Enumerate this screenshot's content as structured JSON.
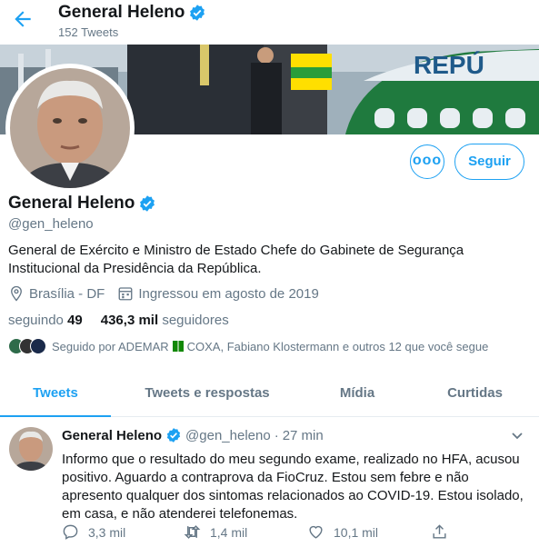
{
  "header": {
    "name": "General Heleno",
    "tweet_count": "152 Tweets"
  },
  "profile": {
    "name": "General Heleno",
    "handle": "@gen_heleno",
    "bio": "General de Exército e Ministro de Estado Chefe do Gabinete de Segurança Institucional da Presidência da República.",
    "bio_line1": "General de Exército e Ministro de Estado Chefe do Gabinete de Segurança",
    "bio_line2": "Institucional da Presidência da República.",
    "location": "Brasília - DF",
    "joined": "Ingressou em agosto de 2019",
    "following_count": "49",
    "following_label": "seguindo",
    "followers_count": "436,3 mil",
    "followers_label": "seguidores",
    "followed_by_prefix": "Seguido por ADEMAR",
    "followed_by_suffix": "COXA, Fabiano Klostermann e outros 12 que você segue",
    "more_label": "ooo",
    "follow_label": "Seguir"
  },
  "tabs": [
    {
      "label": "Tweets",
      "active": true
    },
    {
      "label": "Tweets e respostas",
      "active": false
    },
    {
      "label": "Mídia",
      "active": false
    },
    {
      "label": "Curtidas",
      "active": false
    }
  ],
  "tweet": {
    "name": "General Heleno",
    "handle": "@gen_heleno",
    "separator": "·",
    "time": "27 min",
    "lines": [
      "Informo que o resultado do meu segundo exame, realizado no HFA, acusou",
      "positivo. Aguardo  a contraprova da FioCruz. Estou sem febre e não",
      "apresento qualquer dos sintomas relacionados ao COVID-19. Estou isolado,",
      "em casa, e não atenderei telefonemas."
    ],
    "replies": "3,3 mil",
    "retweets": "1,4 mil",
    "likes": "10,1 mil"
  },
  "colors": {
    "accent": "#1da1f2",
    "muted": "#657786",
    "text": "#14171a"
  },
  "icons": [
    "back-arrow-icon",
    "verified-badge-icon",
    "location-icon",
    "calendar-icon",
    "chevron-down-icon",
    "reply-icon",
    "retweet-icon",
    "like-icon",
    "share-icon"
  ]
}
